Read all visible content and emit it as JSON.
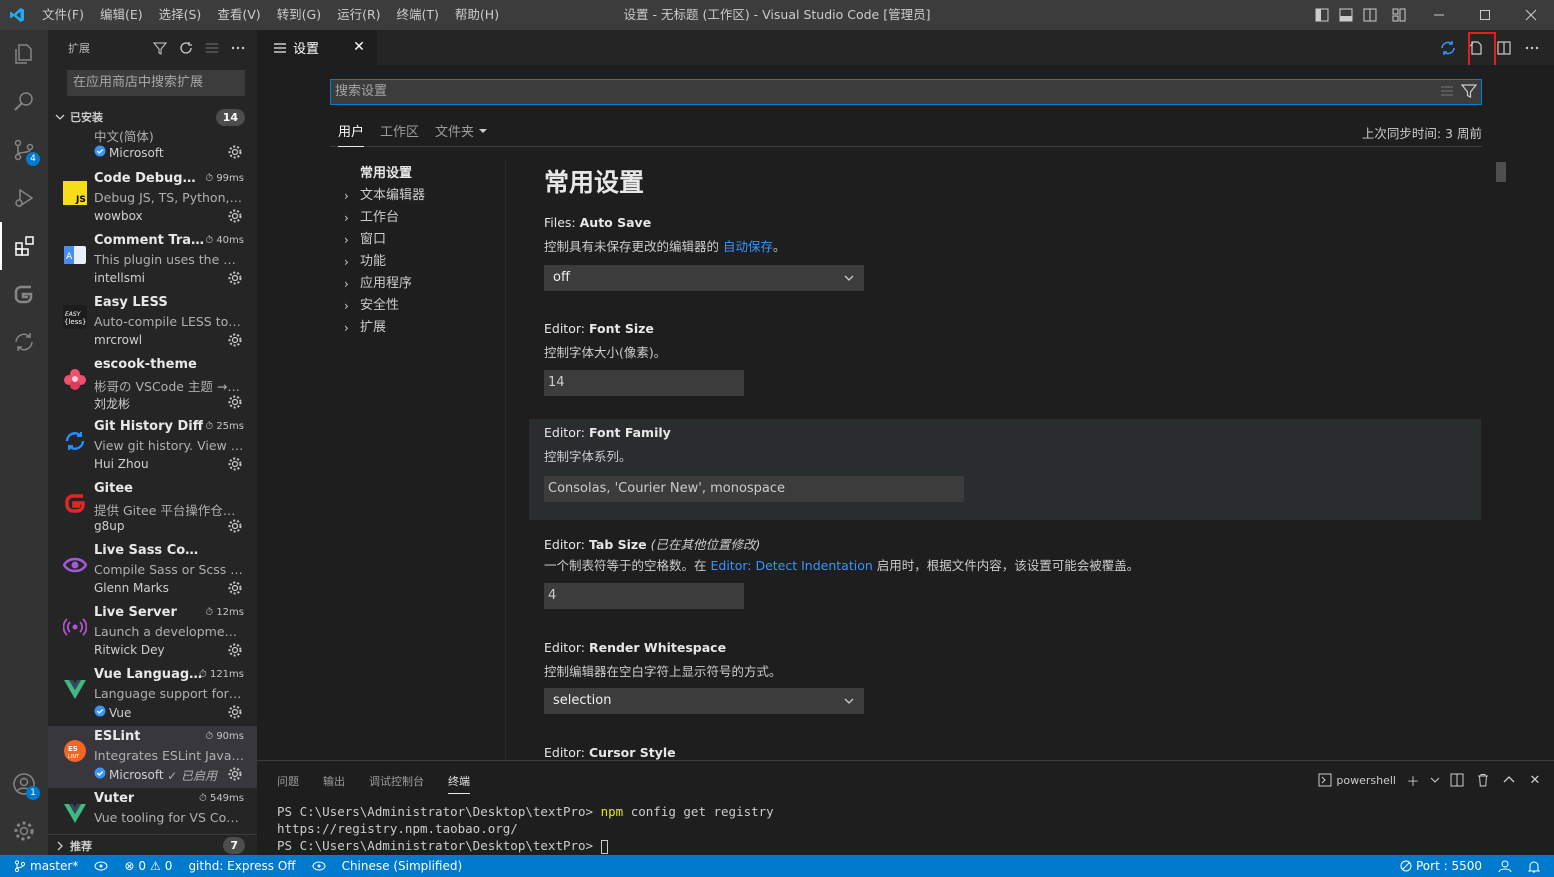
{
  "menu": [
    "文件(F)",
    "编辑(E)",
    "选择(S)",
    "查看(V)",
    "转到(G)",
    "运行(R)",
    "终端(T)",
    "帮助(H)"
  ],
  "window_title": "设置 - 无标题 (工作区) - Visual Studio Code [管理员]",
  "activity": {
    "scm_badge": "4",
    "accounts_badge": "1"
  },
  "sidebar": {
    "title": "扩展",
    "search_placeholder": "在应用商店中搜索扩展",
    "installed_label": "已安装",
    "installed_count": "14",
    "recommended_label": "推荐",
    "recommended_count": "7",
    "extensions": [
      {
        "name": "",
        "time": "",
        "desc": "中文(简体)",
        "publisher": "Microsoft",
        "verified": true
      },
      {
        "name": "Code Debugger",
        "time": "99ms",
        "desc": "Debug JS, TS, Python, G...",
        "publisher": "wowbox"
      },
      {
        "name": "Comment Trans...",
        "time": "40ms",
        "desc": "This plugin uses the Goo...",
        "publisher": "intellsmi"
      },
      {
        "name": "Easy LESS",
        "time": "",
        "desc": "Auto-compile LESS to C...",
        "publisher": "mrcrowl"
      },
      {
        "name": "escook-theme",
        "time": "",
        "desc": "彬哥の VSCode 主题 →_...",
        "publisher": "刘龙彬"
      },
      {
        "name": "Git History Diff",
        "time": "25ms",
        "desc": "View git history. View dif...",
        "publisher": "Hui Zhou"
      },
      {
        "name": "Gitee",
        "time": "",
        "desc": "提供 Gitee 平台操作仓库...",
        "publisher": "g8up"
      },
      {
        "name": "Live Sass Compiler",
        "time": "",
        "desc": "Compile Sass or Scss to ...",
        "publisher": "Glenn Marks"
      },
      {
        "name": "Live Server",
        "time": "12ms",
        "desc": "Launch a development l...",
        "publisher": "Ritwick Dey"
      },
      {
        "name": "Vue Language ...",
        "time": "121ms",
        "desc": "Language support for V...",
        "publisher": "Vue",
        "verified": true
      },
      {
        "name": "ESLint",
        "time": "90ms",
        "desc": "Integrates ESLint JavaScr...",
        "publisher": "Microsoft",
        "verified": true,
        "enabled_note": "已启用"
      },
      {
        "name": "Vuter",
        "time": "549ms",
        "desc": "Vue tooling for VS Code ...",
        "publisher": ""
      }
    ]
  },
  "tab": {
    "label": "设置"
  },
  "settings": {
    "search_placeholder": "搜索设置",
    "tabs": [
      "用户",
      "工作区",
      "文件夹"
    ],
    "last_sync": "上次同步时间: 3 周前",
    "toc": [
      "常用设置",
      "文本编辑器",
      "工作台",
      "窗口",
      "功能",
      "应用程序",
      "安全性",
      "扩展"
    ],
    "section_title": "常用设置",
    "items": [
      {
        "cat": "Files: ",
        "name": "Auto Save",
        "desc_pre": "控制具有未保存更改的编辑器的 ",
        "desc_link": "自动保存",
        "desc_post": "。",
        "value": "off"
      },
      {
        "cat": "Editor: ",
        "name": "Font Size",
        "desc": "控制字体大小(像素)。",
        "value": "14"
      },
      {
        "cat": "Editor: ",
        "name": "Font Family",
        "desc": "控制字体系列。",
        "value": "Consolas, 'Courier New', monospace"
      },
      {
        "cat": "Editor: ",
        "name": "Tab Size",
        "modified": "(已在其他位置修改)",
        "desc_pre": "一个制表符等于的空格数。在 ",
        "desc_link": "Editor: Detect Indentation",
        "desc_post": " 启用时，根据文件内容，该设置可能会被覆盖。",
        "value": "4"
      },
      {
        "cat": "Editor: ",
        "name": "Render Whitespace",
        "desc": "控制编辑器在空白字符上显示符号的方式。",
        "value": "selection"
      },
      {
        "cat": "Editor: ",
        "name": "Cursor Style"
      }
    ]
  },
  "panel": {
    "tabs": [
      "问题",
      "输出",
      "调试控制台",
      "终端"
    ],
    "shell": "powershell",
    "terminal_lines": [
      {
        "prompt": "PS C:\\Users\\Administrator\\Desktop\\textPro> ",
        "cmd": "npm",
        "rest": " config get registry"
      },
      {
        "text": "https://registry.npm.taobao.org/"
      },
      {
        "prompt": "PS C:\\Users\\Administrator\\Desktop\\textPro> "
      }
    ]
  },
  "status": {
    "branch": "master*",
    "errors": "0",
    "warnings": "0",
    "githd": "githd: Express Off",
    "language": "Chinese (Simplified)",
    "port": "Port : 5500"
  },
  "colors": {
    "accent": "#007acc",
    "titlebar": "#3c3c3c",
    "activitybar": "#333333",
    "sidebar": "#252526",
    "editor": "#1e1e1e",
    "highlight_box": "#e02020"
  }
}
